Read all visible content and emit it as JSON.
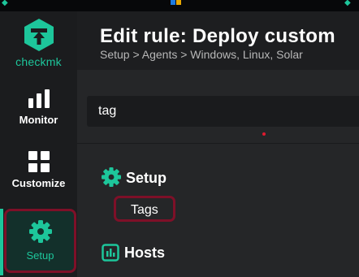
{
  "app": {
    "logo_text": "checkmk",
    "accent_color": "#1dc69b",
    "highlight_border_color": "#7e1028"
  },
  "sidebar": {
    "items": [
      {
        "label": "Monitor",
        "icon": "bar-chart-icon"
      },
      {
        "label": "Customize",
        "icon": "grid-icon"
      },
      {
        "label": "Setup",
        "icon": "gear-icon",
        "selected": true
      }
    ]
  },
  "header": {
    "title": "Edit rule: Deploy custom",
    "breadcrumb": "Setup > Agents > Windows, Linux, Solar"
  },
  "search": {
    "value": "tag"
  },
  "results": {
    "sections": [
      {
        "title": "Setup",
        "icon": "gear-icon",
        "items": [
          "Tags"
        ]
      },
      {
        "title": "Hosts",
        "icon": "hosts-icon",
        "items": []
      }
    ]
  }
}
